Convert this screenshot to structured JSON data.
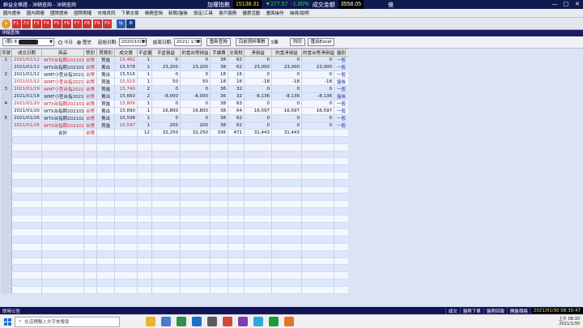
{
  "window": {
    "title": "群益全華證 - 沖銷查詢 - 沖銷查詢",
    "controls": [
      "—",
      "□",
      "✕"
    ]
  },
  "ticker": {
    "label": "加權指數",
    "index": "15138.31",
    "change": "▼277.57",
    "pct": "-1.80%",
    "volume_label": "成交金額",
    "volume": "3558.05",
    "unit": "億"
  },
  "menu": [
    "國內證券",
    "國內期權",
    "國際證券",
    "國際期權",
    "市場資訊",
    "下單交易",
    "帳務查詢",
    "新聞/盤後",
    "設定/工具",
    "客戶服務",
    "優惠活動",
    "畫面操作",
    "袖視/說明"
  ],
  "toolbar": {
    "buttons": [
      "⌂",
      "F1",
      "F2",
      "F3",
      "F4",
      "F5",
      "F6",
      "F7",
      "F8",
      "F9",
      "F0",
      "⇆",
      "⚙"
    ]
  },
  "panel": {
    "title": "沖銷查詢"
  },
  "filter": {
    "account_prefix": "(期) 8",
    "radio_today": "今日",
    "radio_history": "歷史",
    "start_label": "起始日期:",
    "start_date": "2020/10/30",
    "end_label": "結束日期:",
    "end_date": "2021/ 1/30",
    "btn_query": "重新查詢",
    "btn_count_label": "目前資料筆數",
    "count": "5筆",
    "btn_print": "列印",
    "btn_excel": "匯出Excel"
  },
  "table": {
    "headers": [
      "序號",
      "成交日期",
      "商品",
      "幣別",
      "買賣別",
      "成交價",
      "平倉量",
      "平倉損益",
      "約當台幣損益",
      "手續費",
      "交易稅",
      "淨損益",
      "約當淨損益",
      "約當台幣淨損益",
      "盤別"
    ],
    "rows": [
      {
        "seq": "1",
        "date": "2021/01/12",
        "product": "WTX台指期202101",
        "cur": "台幣",
        "side": "買進",
        "price": "15,462",
        "qty": "1",
        "pl": "0",
        "twpl": "0",
        "fee": "38",
        "tax": "62",
        "net": "0",
        "eqnet": "0",
        "twnet": "0",
        "session": "一般",
        "color": "red",
        "group": "odd"
      },
      {
        "seq": "",
        "date": "2021/01/12",
        "product": "WTX台指期202101",
        "cur": "台幣",
        "side": "賣出",
        "price": "15,578",
        "qty": "1",
        "pl": "23,200",
        "twpl": "23,200",
        "fee": "38",
        "tax": "62",
        "net": "23,000",
        "eqnet": "23,000",
        "twnet": "23,000",
        "session": "一般",
        "color": "blk",
        "group": "odd"
      },
      {
        "seq": "2",
        "date": "2021/01/12",
        "product": "WMT小型台指202101",
        "cur": "台幣",
        "side": "賣出",
        "price": "15,516",
        "qty": "1",
        "pl": "0",
        "twpl": "0",
        "fee": "18",
        "tax": "16",
        "net": "0",
        "eqnet": "0",
        "twnet": "0",
        "session": "一般",
        "color": "blk",
        "group": "even"
      },
      {
        "seq": "",
        "date": "2021/01/12",
        "product": "WMT小型台指202101",
        "cur": "台幣",
        "side": "買進",
        "price": "15,515",
        "qty": "1",
        "pl": "50",
        "twpl": "50",
        "fee": "18",
        "tax": "16",
        "net": "-18",
        "eqnet": "-18",
        "twnet": "-18",
        "session": "盤後",
        "color": "red",
        "group": "even"
      },
      {
        "seq": "3",
        "date": "2021/01/19",
        "product": "WMT小型台指202101",
        "cur": "台幣",
        "side": "買進",
        "price": "15,740",
        "qty": "2",
        "pl": "0",
        "twpl": "0",
        "fee": "36",
        "tax": "32",
        "net": "0",
        "eqnet": "0",
        "twnet": "0",
        "session": "一般",
        "color": "red",
        "group": "odd"
      },
      {
        "seq": "",
        "date": "2021/01/18",
        "product": "WMT小型台指202101",
        "cur": "台幣",
        "side": "賣出",
        "price": "15,660",
        "qty": "2",
        "pl": "-8,000",
        "twpl": "-8,000",
        "fee": "36",
        "tax": "32",
        "net": "-8,136",
        "eqnet": "-8,136",
        "twnet": "-8,136",
        "session": "盤後",
        "color": "blk",
        "group": "odd"
      },
      {
        "seq": "4",
        "date": "2021/01/20",
        "product": "WTX台指期202101",
        "cur": "台幣",
        "side": "買進",
        "price": "15,806",
        "qty": "1",
        "pl": "0",
        "twpl": "0",
        "fee": "38",
        "tax": "63",
        "net": "0",
        "eqnet": "0",
        "twnet": "0",
        "session": "一般",
        "color": "red",
        "group": "even"
      },
      {
        "seq": "",
        "date": "2021/01/20",
        "product": "WTX台指期202101",
        "cur": "台幣",
        "side": "賣出",
        "price": "15,890",
        "qty": "1",
        "pl": "16,800",
        "twpl": "16,800",
        "fee": "38",
        "tax": "64",
        "net": "16,597",
        "eqnet": "16,597",
        "twnet": "16,597",
        "session": "一般",
        "color": "blk",
        "group": "even"
      },
      {
        "seq": "5",
        "date": "2021/01/26",
        "product": "WTX台指期202102",
        "cur": "台幣",
        "side": "賣出",
        "price": "15,598",
        "qty": "1",
        "pl": "0",
        "twpl": "0",
        "fee": "38",
        "tax": "62",
        "net": "0",
        "eqnet": "0",
        "twnet": "0",
        "session": "一般",
        "color": "blk",
        "group": "odd"
      },
      {
        "seq": "",
        "date": "2021/01/26",
        "product": "WTX台指期202102",
        "cur": "台幣",
        "side": "買進",
        "price": "15,597",
        "qty": "1",
        "pl": "200",
        "twpl": "200",
        "fee": "38",
        "tax": "62",
        "net": "0",
        "eqnet": "0",
        "twnet": "0",
        "session": "一般",
        "color": "red",
        "group": "odd"
      }
    ],
    "total": {
      "label": "合計",
      "cur": "台幣",
      "qty": "12",
      "pl": "32,250",
      "twpl": "32,250",
      "fee": "336",
      "tax": "471",
      "net": "31,443",
      "eqnet": "31,443"
    }
  },
  "status": {
    "left": "即時公告",
    "items": [
      "成交",
      "盤勢下單",
      "盤勢回報",
      "開盤價格"
    ],
    "time": "2021/01/30 08:30:47"
  },
  "taskbar": {
    "search_placeholder": "在這裡輸入文字來搜尋",
    "time": "上午 08:30",
    "date": "2021/1/30"
  },
  "colors": {
    "title_bg": "#0f1a4f",
    "header_bg": "#1c1e5f",
    "row_odd": "#dde6fb",
    "row_even": "#f4f7ff",
    "loss_red": "#d22525",
    "index_yellow": "#f5e84a",
    "change_green": "#31d24b"
  }
}
